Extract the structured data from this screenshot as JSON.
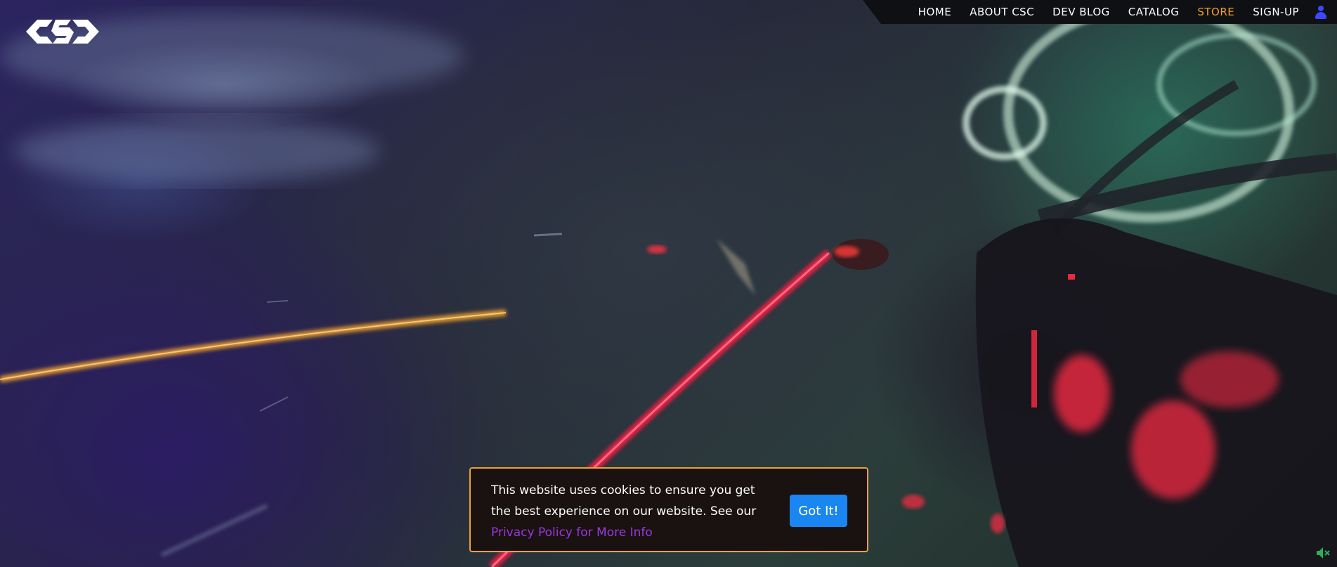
{
  "nav": {
    "items": [
      {
        "label": "HOME",
        "active": false
      },
      {
        "label": "ABOUT CSC",
        "active": false
      },
      {
        "label": "DEV BLOG",
        "active": false
      },
      {
        "label": "CATALOG",
        "active": false
      },
      {
        "label": "STORE",
        "active": true
      },
      {
        "label": "SIGN-UP",
        "active": false
      }
    ],
    "user_icon": "user-icon",
    "active_color": "#f5a121"
  },
  "logo": {
    "icon": "csc-logo"
  },
  "cookie_banner": {
    "text": "This website uses cookies to ensure you get the best experience on our website. See our ",
    "link_text": "Privacy Policy for More Info",
    "button_label": "Got It!",
    "border_color": "#e7a23b",
    "button_color": "#1a86f2",
    "link_color": "#9a37e0"
  },
  "video": {
    "mute_icon": "muted-speaker-icon"
  }
}
